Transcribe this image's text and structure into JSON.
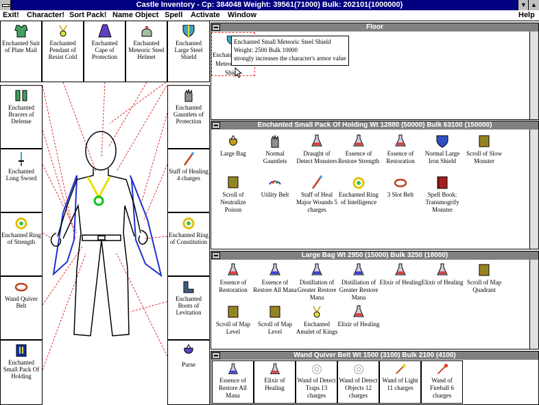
{
  "window": {
    "title": "Castle Inventory - Cp: 384048 Weight: 39561(71000) Bulk: 202101(1000000)",
    "minimize_glyph": "▼",
    "maximize_glyph": "▲"
  },
  "menu": {
    "items": [
      "Exit!",
      "Character!",
      "Sort Pack!",
      "Name Object",
      "Spell",
      "Activate",
      "Window"
    ],
    "help": "Help"
  },
  "equipment": {
    "top": [
      {
        "label": "Enchanted Suit of Plate Mail",
        "icon": "armor-icon"
      },
      {
        "label": "Enchanted Pendant of Resist Cold",
        "icon": "pendant-icon"
      },
      {
        "label": "Enchanted Cape of Protection",
        "icon": "cape-icon"
      },
      {
        "label": "Enchanted Meteoric Steel Helmet",
        "icon": "helmet-icon"
      },
      {
        "label": "Enchanted Large Steel Shield",
        "icon": "shield-icon"
      }
    ],
    "left": [
      {
        "label": "Enchanted Bracers of Defense",
        "icon": "bracers-icon"
      },
      {
        "label": "Enchanted Long Sword",
        "icon": "sword-icon"
      },
      {
        "label": "Enchanted Ring of Strength",
        "icon": "ring-icon"
      },
      {
        "label": "Wand Quiver Belt",
        "icon": "belt-icon"
      },
      {
        "label": "Enchanted Small Pack Of Holding",
        "icon": "pack-icon"
      }
    ],
    "right": [
      {
        "label": "Enchanted Gauntlets of Protection",
        "icon": "gauntlets-icon"
      },
      {
        "label": "Staff of Healing 4 charges",
        "icon": "staff-icon"
      },
      {
        "label": "Enchanted Ring of Constitution",
        "icon": "ring-icon"
      },
      {
        "label": "Enchanted Boots of Levitation",
        "icon": "boots-icon"
      },
      {
        "label": "Purse",
        "icon": "purse-icon"
      }
    ]
  },
  "floor": {
    "title": "Floor",
    "item_label": "Enchanted Small Meteoric Steel Shield",
    "item_label_fragments": [
      "Enchan",
      "Meteo",
      "Shie"
    ]
  },
  "tooltip": {
    "name": "Enchanted Small Meteoric Steel Shield",
    "stats": "Weight: 2500 Bulk 10000",
    "desc": "strongly increases the character's armor value"
  },
  "pack": {
    "title": "Enchanted Small Pack Of Holding Wt 12880 (50000) Bulk 63100 (150000)",
    "items": [
      {
        "label": "Large Bag",
        "icon": "bag-icon"
      },
      {
        "label": "Normal Gauntlets",
        "icon": "gauntlets-icon"
      },
      {
        "label": "Draught of Detect Monsters",
        "icon": "potion-icon"
      },
      {
        "label": "Essence of Restore Strength",
        "icon": "potion-icon"
      },
      {
        "label": "Essence of Restoration",
        "icon": "potion-icon"
      },
      {
        "label": "Normal Large Iron Shield",
        "icon": "shield-icon"
      },
      {
        "label": "Scroll of Slow Monster",
        "icon": "scroll-icon"
      },
      {
        "label": "Scroll of Neutralize Poison",
        "icon": "scroll-icon"
      },
      {
        "label": "Utility Belt",
        "icon": "belt-icon"
      },
      {
        "label": "Staff of Heal Major Wounds 5 charges",
        "icon": "staff-icon"
      },
      {
        "label": "Enchanted Ring of Intelligence",
        "icon": "ring-icon"
      },
      {
        "label": "3 Slot Belt",
        "icon": "belt-icon"
      },
      {
        "label": "Spell Book: Transmogrify Monster",
        "icon": "book-icon"
      }
    ]
  },
  "bag": {
    "title": "Large Bag Wt 2950 (15000) Bulk 3250 (18000)",
    "items": [
      {
        "label": "Essence of Restoration",
        "icon": "potion-icon"
      },
      {
        "label": "Essence of Restore All Mana",
        "icon": "potion-icon"
      },
      {
        "label": "Distillation of Greater Restore Mana",
        "icon": "potion-icon"
      },
      {
        "label": "Distillation of Greater Restore Mana",
        "icon": "potion-icon"
      },
      {
        "label": "Elixir of Healing",
        "icon": "potion-icon"
      },
      {
        "label": "Elixir of Healing",
        "icon": "potion-icon"
      },
      {
        "label": "Scroll of Map Quadrant",
        "icon": "scroll-icon"
      },
      {
        "label": "Scroll of Map Level",
        "icon": "scroll-icon"
      },
      {
        "label": "Scroll of Map Level",
        "icon": "scroll-icon"
      },
      {
        "label": "Enchanted Amulet of Kings",
        "icon": "amulet-icon"
      },
      {
        "label": "Elixir of Healing",
        "icon": "potion-icon"
      }
    ]
  },
  "quiver": {
    "title": "Wand Quiver Belt Wt 1500 (3100) Bulk 2100 (4100)",
    "items": [
      {
        "label": "Essence of Restore All Mana",
        "icon": "potion-icon"
      },
      {
        "label": "Elixir of Healing",
        "icon": "potion-icon"
      },
      {
        "label": "Wand of Detect Traps 13 charges",
        "icon": "wand-icon"
      },
      {
        "label": "Wand of Detect Objects 12 charges",
        "icon": "wand-icon"
      },
      {
        "label": "Wand of Light 11 charges",
        "icon": "wand-icon"
      },
      {
        "label": "Wand of Fireball 6 charges",
        "icon": "wand-icon"
      }
    ]
  },
  "colors": {
    "title_bar": "#000080",
    "panel_header": "#808080",
    "cape_blue": "#1c2fd0",
    "amulet_yellow": "#e8e000",
    "amulet_green": "#10c020",
    "link_line_red": "#e03030"
  }
}
